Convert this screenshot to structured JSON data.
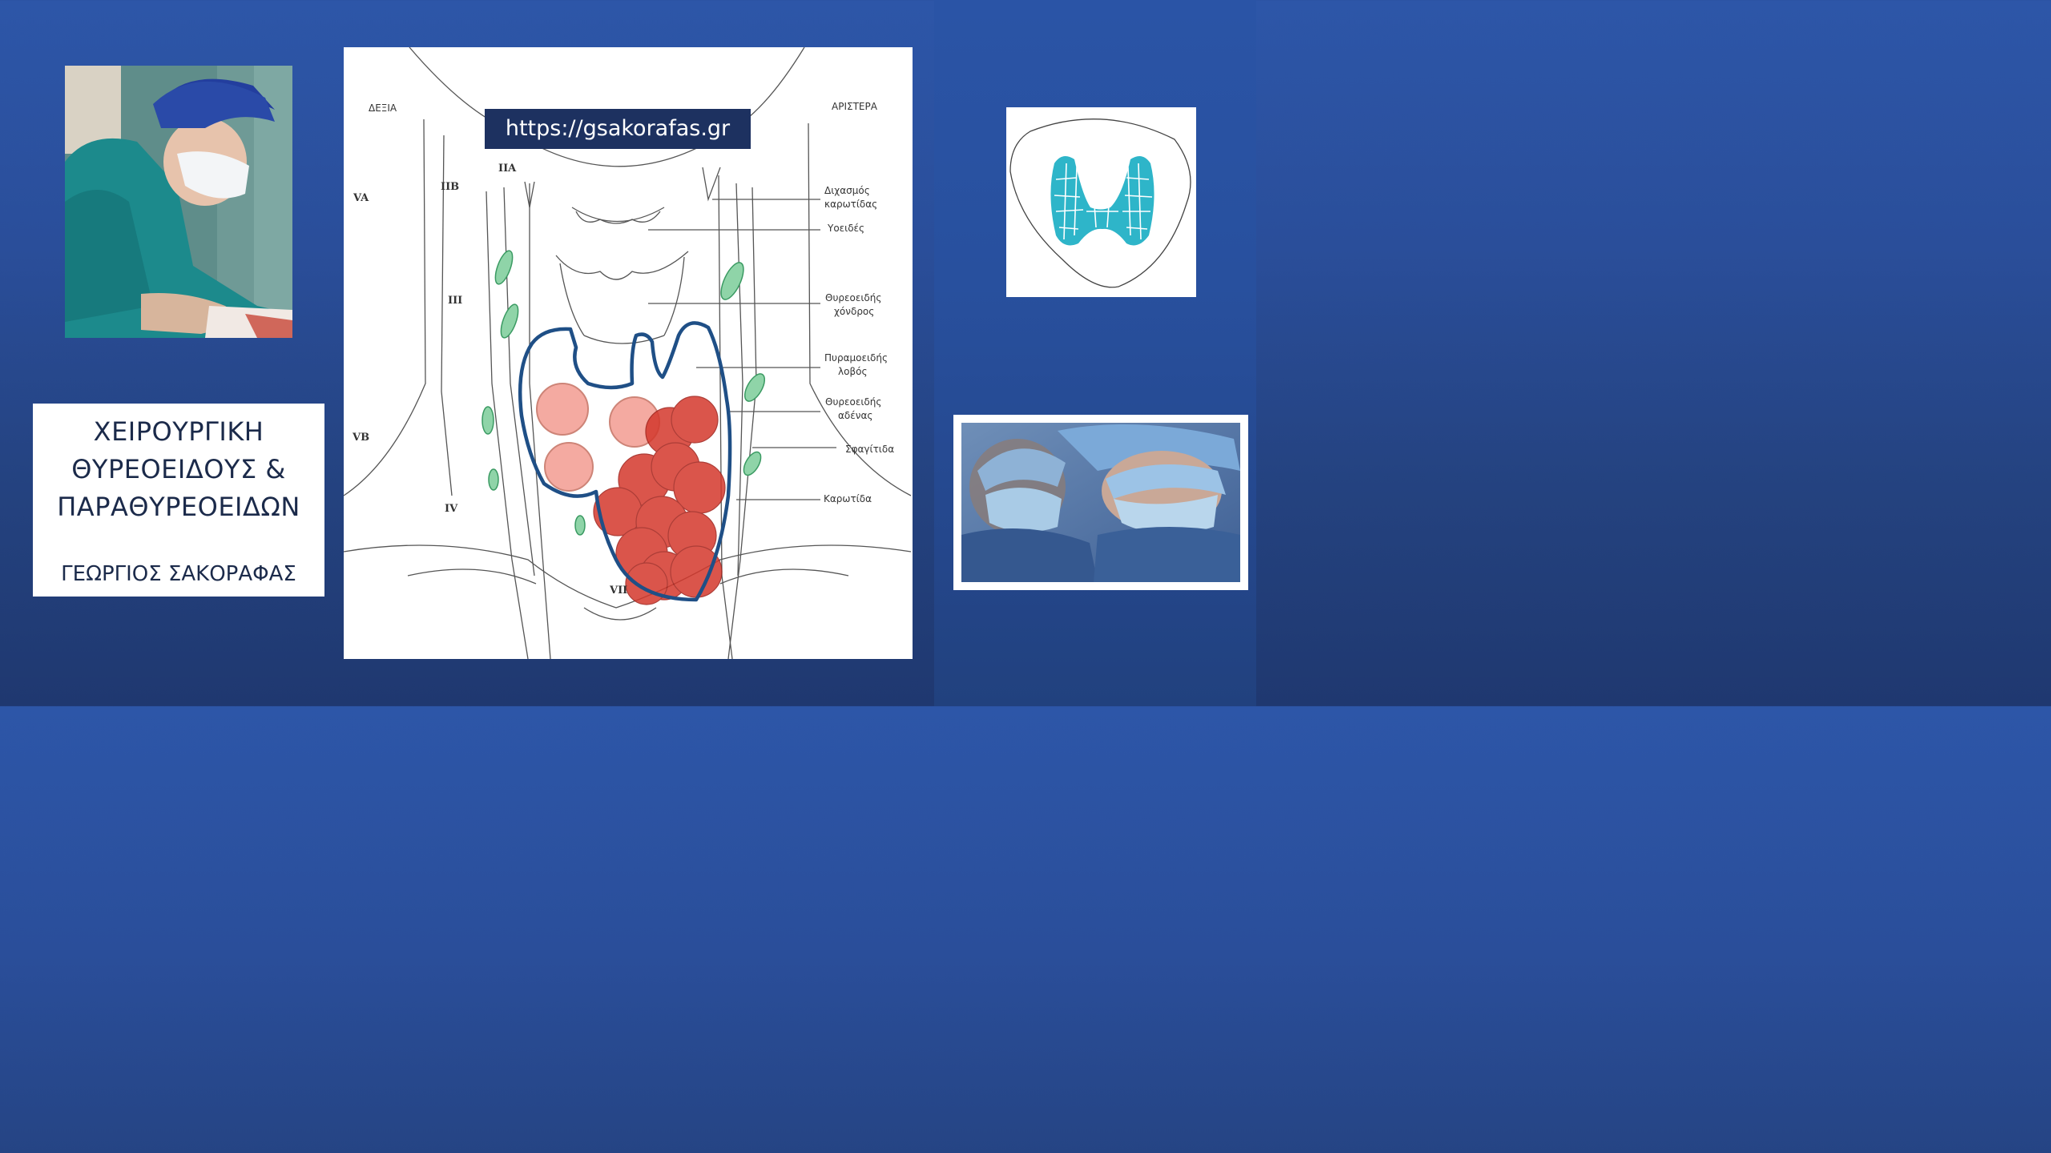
{
  "title_card": {
    "title_lines": [
      "ΧΕΙΡΟΥΡΓΙΚΗ",
      "ΘΥΡΕΟΕΙΔΟΥΣ &",
      "ΠΑΡΑΘΥΡΕΟΕΙΔΩΝ"
    ],
    "author": "ΓΕΩΡΓΙΟΣ ΣΑΚΟΡΑΦΑΣ"
  },
  "url_banner": "https://gsakorafas.gr",
  "diagram": {
    "side_right_patient": "ΔΕΞΙΑ",
    "side_left_patient": "ΑΡΙΣΤΕΡΑ",
    "levels": {
      "IIA": "IIA",
      "IIB": "IIB",
      "VA": "VA",
      "III": "III",
      "VB": "VB",
      "IV": "IV",
      "VII": "VII"
    },
    "anatomy_labels": {
      "carotid_bifurcation": [
        "Διχασμός",
        "καρωτίδας"
      ],
      "hyoid": [
        "Υοειδές"
      ],
      "thyroid_cartilage": [
        "Θυρεοειδής",
        "χόνδρος"
      ],
      "pyramidal_lobe": [
        "Πυραμοειδής",
        "λοβός"
      ],
      "thyroid_gland": [
        "Θυρεοειδής",
        "αδένας"
      ],
      "jugular": [
        "Σφαγίτιδα"
      ],
      "carotid": [
        "Καρωτίδα"
      ]
    }
  },
  "colors": {
    "background": "#2a4e9a",
    "banner": "#1d3160",
    "gland_outline": "#1f4f86",
    "nodule_light": "#f4a39a",
    "nodule_dark": "#d4382c",
    "lymph_node": "#8fd4a8",
    "thyroid_icon": "#2eb5c9"
  },
  "images": {
    "surgeon_photo": "surgeon-in-scrubs-photo",
    "team_photo": "surgical-team-photo",
    "thyroid_icon": "thyroid-gland-icon"
  }
}
